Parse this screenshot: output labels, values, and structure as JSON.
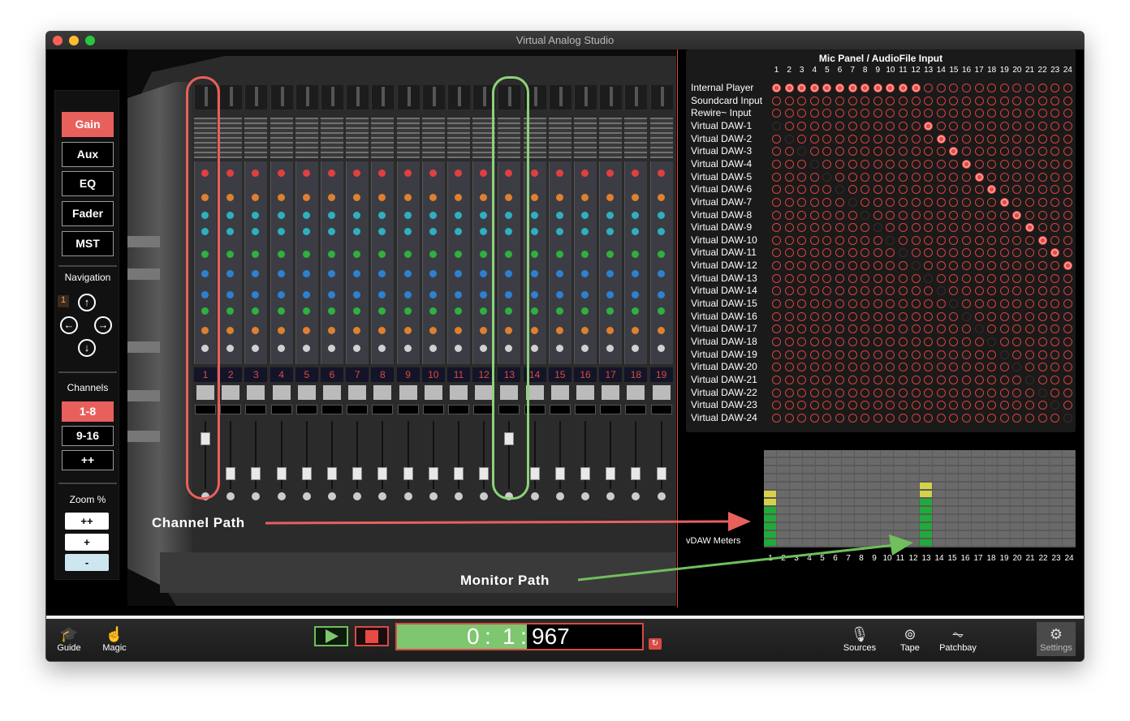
{
  "window": {
    "title": "Virtual Analog Studio"
  },
  "sidebar": {
    "modes": [
      {
        "label": "Gain",
        "active": true
      },
      {
        "label": "Aux",
        "active": false
      },
      {
        "label": "EQ",
        "active": false
      },
      {
        "label": "Fader",
        "active": false
      },
      {
        "label": "MST",
        "active": false
      }
    ],
    "navigation_label": "Navigation",
    "navigation_index": "1",
    "channels_label": "Channels",
    "channel_groups": [
      {
        "label": "1-8",
        "active": true
      },
      {
        "label": "9-16",
        "active": false
      },
      {
        "label": "++",
        "active": false
      }
    ],
    "zoom_label": "Zoom %",
    "zoom_buttons": [
      "++",
      "+",
      "-"
    ]
  },
  "console": {
    "channel_numbers": [
      "1",
      "2",
      "3",
      "4",
      "5",
      "6",
      "7",
      "8",
      "9",
      "10",
      "11",
      "12",
      "13",
      "14",
      "15",
      "16",
      "17",
      "18",
      "19"
    ]
  },
  "annotations": {
    "channel_path": "Channel Path",
    "monitor_path": "Monitor Path"
  },
  "matrix": {
    "title": "Mic Panel / AudioFile Input",
    "columns": [
      "1",
      "2",
      "3",
      "4",
      "5",
      "6",
      "7",
      "8",
      "9",
      "10",
      "11",
      "12",
      "13",
      "14",
      "15",
      "16",
      "17",
      "18",
      "19",
      "20",
      "21",
      "22",
      "23",
      "24"
    ],
    "rows": [
      "Internal Player",
      "Soundcard Input",
      "Rewire~ Input",
      "Virtual DAW-1",
      "Virtual DAW-2",
      "Virtual DAW-3",
      "Virtual DAW-4",
      "Virtual DAW-5",
      "Virtual DAW-6",
      "Virtual DAW-7",
      "Virtual DAW-8",
      "Virtual DAW-9",
      "Virtual DAW-10",
      "Virtual DAW-11",
      "Virtual DAW-12",
      "Virtual DAW-13",
      "Virtual DAW-14",
      "Virtual DAW-15",
      "Virtual DAW-16",
      "Virtual DAW-17",
      "Virtual DAW-18",
      "Virtual DAW-19",
      "Virtual DAW-20",
      "Virtual DAW-21",
      "Virtual DAW-22",
      "Virtual DAW-23",
      "Virtual DAW-24"
    ]
  },
  "meters": {
    "label": "vDAW Meters",
    "columns": [
      "1",
      "2",
      "3",
      "4",
      "5",
      "6",
      "7",
      "8",
      "9",
      "10",
      "11",
      "12",
      "13",
      "14",
      "15",
      "16",
      "17",
      "18",
      "19",
      "20",
      "21",
      "22",
      "23",
      "24"
    ],
    "levels": [
      0.55,
      0,
      0,
      0,
      0,
      0,
      0,
      0,
      0,
      0,
      0,
      0,
      0.65,
      0,
      0,
      0,
      0,
      0,
      0,
      0,
      0,
      0,
      0,
      0
    ]
  },
  "transport": {
    "time_minutes": "0",
    "time_seconds": "1",
    "time_ms": "967"
  },
  "bottombar": {
    "guide": "Guide",
    "magic": "Magic",
    "sources": "Sources",
    "tape": "Tape",
    "patchbay": "Patchbay",
    "settings": "Settings"
  },
  "colors": {
    "accent": "#e8605c",
    "green": "#7fc670",
    "red": "#d84b45"
  }
}
